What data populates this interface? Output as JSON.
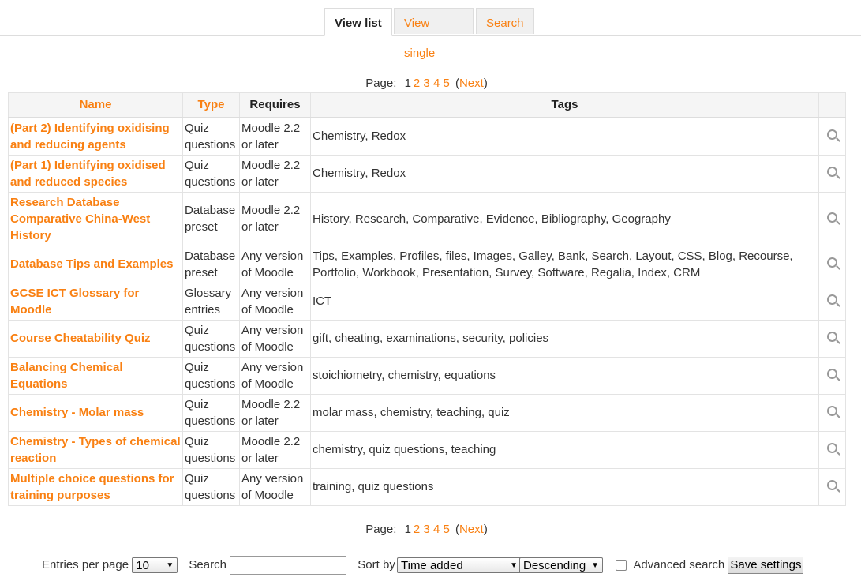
{
  "tabs": [
    {
      "label": "View list",
      "active": true
    },
    {
      "label": "View single",
      "active": false
    },
    {
      "label": "Search",
      "active": false
    }
  ],
  "pager": {
    "label": "Page:",
    "current": "1",
    "pages": [
      "2",
      "3",
      "4",
      "5"
    ],
    "next": "Next"
  },
  "table": {
    "headers": {
      "name": "Name",
      "type": "Type",
      "requires": "Requires",
      "tags": "Tags"
    },
    "rows": [
      {
        "name": "(Part 2) Identifying oxidising and reducing agents",
        "type": "Quiz questions",
        "requires": "Moodle 2.2 or later",
        "tags": "Chemistry, Redox"
      },
      {
        "name": "(Part 1) Identifying oxidised and reduced species",
        "type": "Quiz questions",
        "requires": "Moodle 2.2 or later",
        "tags": "Chemistry, Redox"
      },
      {
        "name": "Research Database Comparative China-West History",
        "type": "Database preset",
        "requires": "Moodle 2.2 or later",
        "tags": "History, Research, Comparative, Evidence, Bibliography, Geography"
      },
      {
        "name": "Database Tips and Examples",
        "type": "Database preset",
        "requires": "Any version of Moodle",
        "tags": "Tips, Examples, Profiles, files, Images, Galley, Bank, Search, Layout, CSS, Blog, Recourse, Portfolio, Workbook, Presentation, Survey, Software, Regalia, Index, CRM"
      },
      {
        "name": "GCSE ICT Glossary for Moodle",
        "type": "Glossary entries",
        "requires": "Any version of Moodle",
        "tags": "ICT"
      },
      {
        "name": "Course Cheatability Quiz",
        "type": "Quiz questions",
        "requires": "Any version of Moodle",
        "tags": "gift, cheating, examinations, security, policies"
      },
      {
        "name": "Balancing Chemical Equations",
        "type": "Quiz questions",
        "requires": "Any version of Moodle",
        "tags": "stoichiometry, chemistry, equations"
      },
      {
        "name": "Chemistry - Molar mass",
        "type": "Quiz questions",
        "requires": "Moodle 2.2 or later",
        "tags": "molar mass, chemistry, teaching, quiz"
      },
      {
        "name": "Chemistry - Types of chemical reaction",
        "type": "Quiz questions",
        "requires": "Moodle 2.2 or later",
        "tags": "chemistry, quiz questions, teaching"
      },
      {
        "name": "Multiple choice questions for training purposes",
        "type": "Quiz questions",
        "requires": "Any version of Moodle",
        "tags": "training, quiz questions"
      }
    ]
  },
  "controls": {
    "per_page_label": "Entries per page",
    "per_page_value": "10",
    "search_label": "Search",
    "search_value": "",
    "sort_label": "Sort by",
    "sort_value": "Time added",
    "order_value": "Descending",
    "advanced_label": "Advanced search",
    "advanced_checked": false,
    "save_label": "Save settings"
  },
  "icons": {
    "view": "magnifier-icon",
    "dropdown": "chevron-down-icon"
  },
  "colors": {
    "accent": "#f98012",
    "header_bg": "#f5f5f5"
  }
}
